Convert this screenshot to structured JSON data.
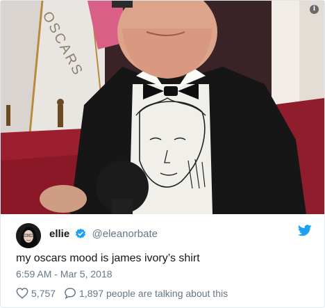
{
  "photo": {
    "backdrop_text": "OSCARS"
  },
  "tweet": {
    "display_name": "ellie",
    "handle": "@eleanorbate",
    "text": "my oscars mood is james ivory’s shirt",
    "timestamp": "6:59 AM - Mar 5, 2018",
    "likes": "5,757",
    "talking": "1,897 people are talking about this"
  },
  "icons": {
    "info": "info-icon",
    "verified": "verified-badge-icon",
    "brand": "twitter-bird-icon",
    "like": "heart-icon",
    "reply": "speech-bubble-icon"
  },
  "colors": {
    "twitter_blue": "#1da1f2",
    "text_primary": "#14171a",
    "text_secondary": "#657786",
    "red_carpet": "#9b1f2e"
  }
}
